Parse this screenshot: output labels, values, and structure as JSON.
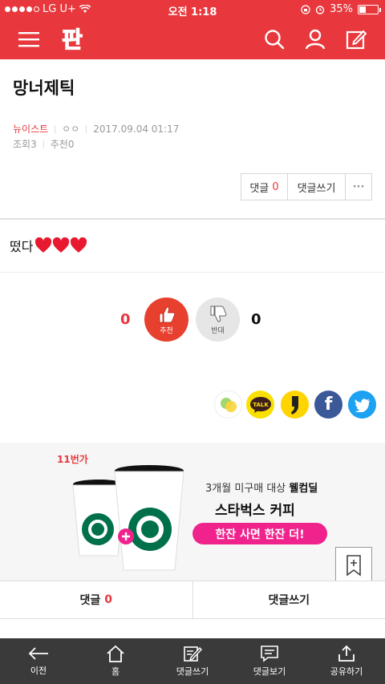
{
  "status_bar": {
    "carrier": "LG U+",
    "time": "오전 1:18",
    "battery": "35%",
    "battery_level": 0.35
  },
  "header": {
    "logo_text": "판",
    "icons": [
      "menu-icon",
      "search-icon",
      "user-icon",
      "write-icon"
    ]
  },
  "article": {
    "title": "망너제틱",
    "category": "뉴이스트",
    "author": "ㅇㅇ",
    "datetime": "2017.09.04 01:17",
    "views_label": "조회",
    "views": "3",
    "recommend_label": "추천",
    "recommend_count": "0",
    "body": "떴다"
  },
  "actions": {
    "comments_label": "댓글",
    "comments_count": "0",
    "write_label": "댓글쓰기",
    "more_label": "···"
  },
  "votes": {
    "up_count": "0",
    "up_label": "추천",
    "down_count": "0",
    "down_label": "반대"
  },
  "share": {
    "talk_label": "TALK",
    "facebook_label": "f"
  },
  "ad": {
    "brand": "11번가",
    "line1_prefix": "3개월 미구매 대상 ",
    "line1_bold": "웰컴딜",
    "line2": "스타벅스 커피",
    "pill": "한잔 사면 한잔 더!"
  },
  "comment_bar": {
    "comments_label": "댓글",
    "comments_count": "0",
    "write_label": "댓글쓰기"
  },
  "toolbar": {
    "items": [
      {
        "label": "이전"
      },
      {
        "label": "홈"
      },
      {
        "label": "댓글쓰기"
      },
      {
        "label": "댓글보기"
      },
      {
        "label": "공유하기"
      }
    ]
  },
  "colors": {
    "brand_red": "#e8383d",
    "toolbar_bg": "#3a3a3a",
    "ad_pink": "#f0238d"
  }
}
